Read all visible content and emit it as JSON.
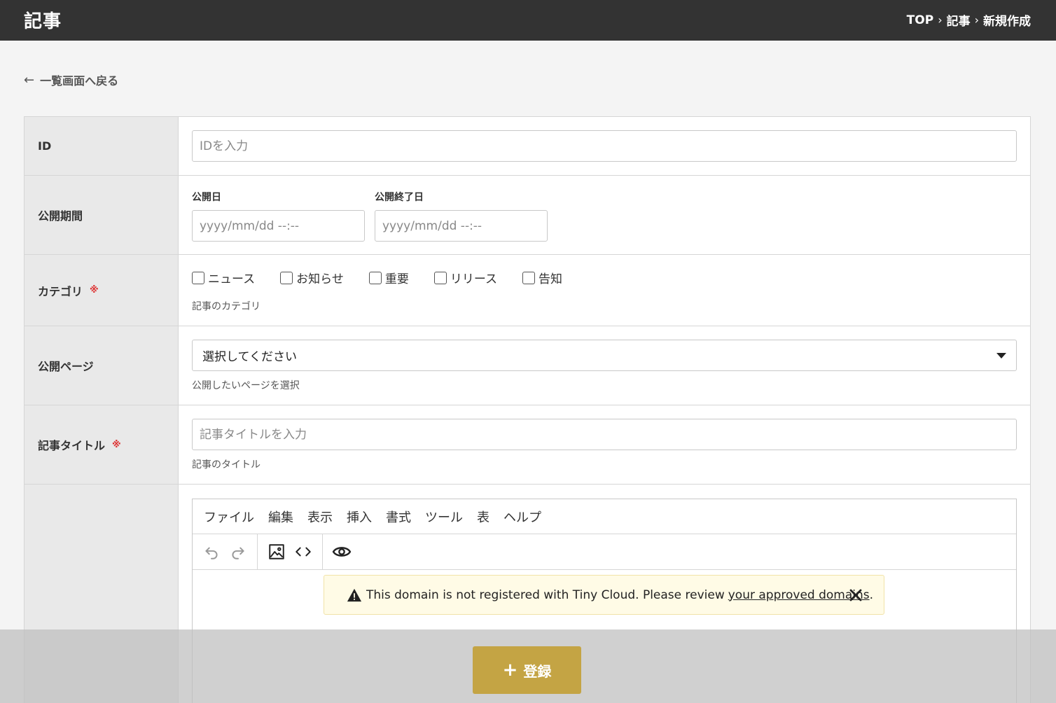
{
  "header": {
    "title": "記事",
    "breadcrumb": [
      "TOP",
      "記事",
      "新規作成"
    ],
    "separator": "›"
  },
  "back_link": {
    "arrow": "←",
    "label": "一覧画面へ戻る"
  },
  "form": {
    "id": {
      "label": "ID",
      "placeholder": "IDを入力"
    },
    "period": {
      "label": "公開期間",
      "start_label": "公開日",
      "start_placeholder": "yyyy/mm/dd --:--",
      "end_label": "公開終了日",
      "end_placeholder": "yyyy/mm/dd --:--"
    },
    "category": {
      "label": "カテゴリ",
      "required_mark": "※",
      "options": [
        "ニュース",
        "お知らせ",
        "重要",
        "リリース",
        "告知"
      ],
      "help": "記事のカテゴリ"
    },
    "page": {
      "label": "公開ページ",
      "selected": "選択してください",
      "help": "公開したいページを選択"
    },
    "title": {
      "label": "記事タイトル",
      "required_mark": "※",
      "placeholder": "記事タイトルを入力",
      "help": "記事のタイトル"
    },
    "editor": {
      "menu": [
        "ファイル",
        "編集",
        "表示",
        "挿入",
        "書式",
        "ツール",
        "表",
        "ヘルプ"
      ],
      "toolbar_icons": [
        "undo-icon",
        "redo-icon",
        "image-icon",
        "code-icon",
        "preview-icon"
      ],
      "notice": {
        "text": "This domain is not registered with Tiny Cloud. Please review",
        "link": "your approved domains",
        "suffix": "."
      }
    }
  },
  "submit": {
    "icon": "+",
    "label": "登録",
    "color": "#c4a444"
  }
}
